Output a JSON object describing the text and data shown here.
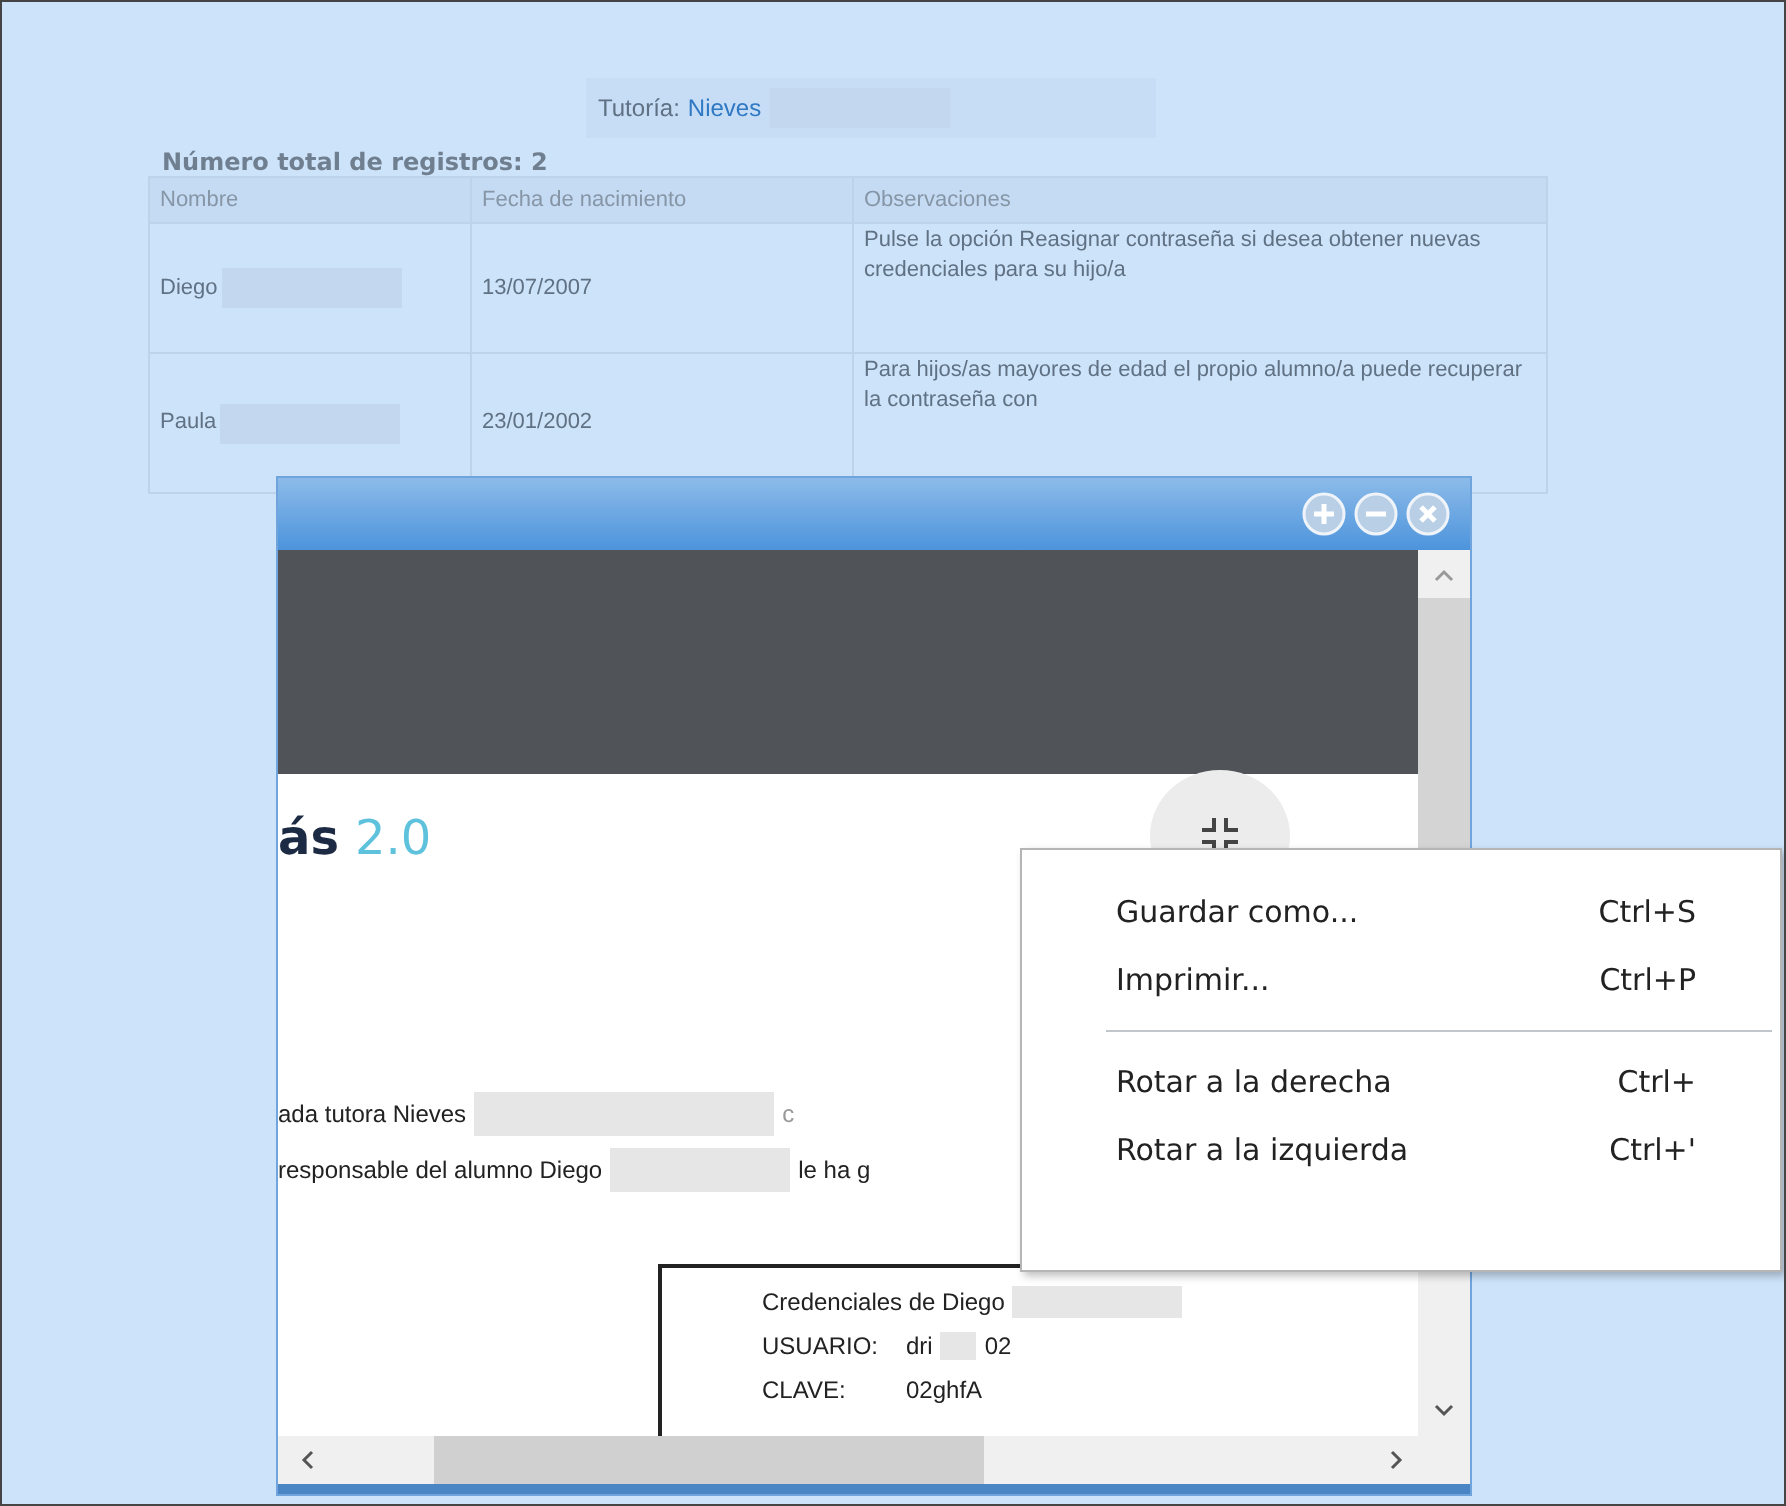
{
  "tutoria": {
    "label": "Tutoría:",
    "name": "Nieves"
  },
  "total_records": "Número total de registros: 2",
  "table": {
    "columns": [
      "Nombre",
      "Fecha de nacimiento",
      "Observaciones"
    ],
    "rows": [
      {
        "name": "Diego",
        "birth_date": "13/07/2007",
        "notes": "Pulse la opción Reasignar contraseña si desea obtener nuevas credenciales para su hijo/a"
      },
      {
        "name": "Paula",
        "birth_date": "23/01/2002",
        "notes": "Para hijos/as mayores de edad el propio alumno/a puede recuperar la contraseña con"
      }
    ]
  },
  "viewer": {
    "document": {
      "logo_text": "ás",
      "logo_version": "2.0",
      "greeting": "ada tutora Nieves",
      "greeting_end": "c",
      "body_line": "responsable del alumno Diego",
      "body_line_end": "le ha g",
      "credentials": {
        "title": "Credenciales de Diego",
        "fields": [
          {
            "label": "USUARIO:",
            "value_start": "dri",
            "value_end": "02"
          },
          {
            "label": "CLAVE:",
            "value_start": "02ghfA"
          }
        ]
      }
    }
  },
  "context_menu": {
    "sections": [
      [
        {
          "label": "Guardar como...",
          "shortcut": "Ctrl+S"
        },
        {
          "label": "Imprimir...",
          "shortcut": "Ctrl+P"
        }
      ],
      [
        {
          "label": "Rotar a la derecha",
          "shortcut": "Ctrl+"
        },
        {
          "label": "Rotar a la izquierda",
          "shortcut": "Ctrl+'"
        }
      ]
    ]
  }
}
